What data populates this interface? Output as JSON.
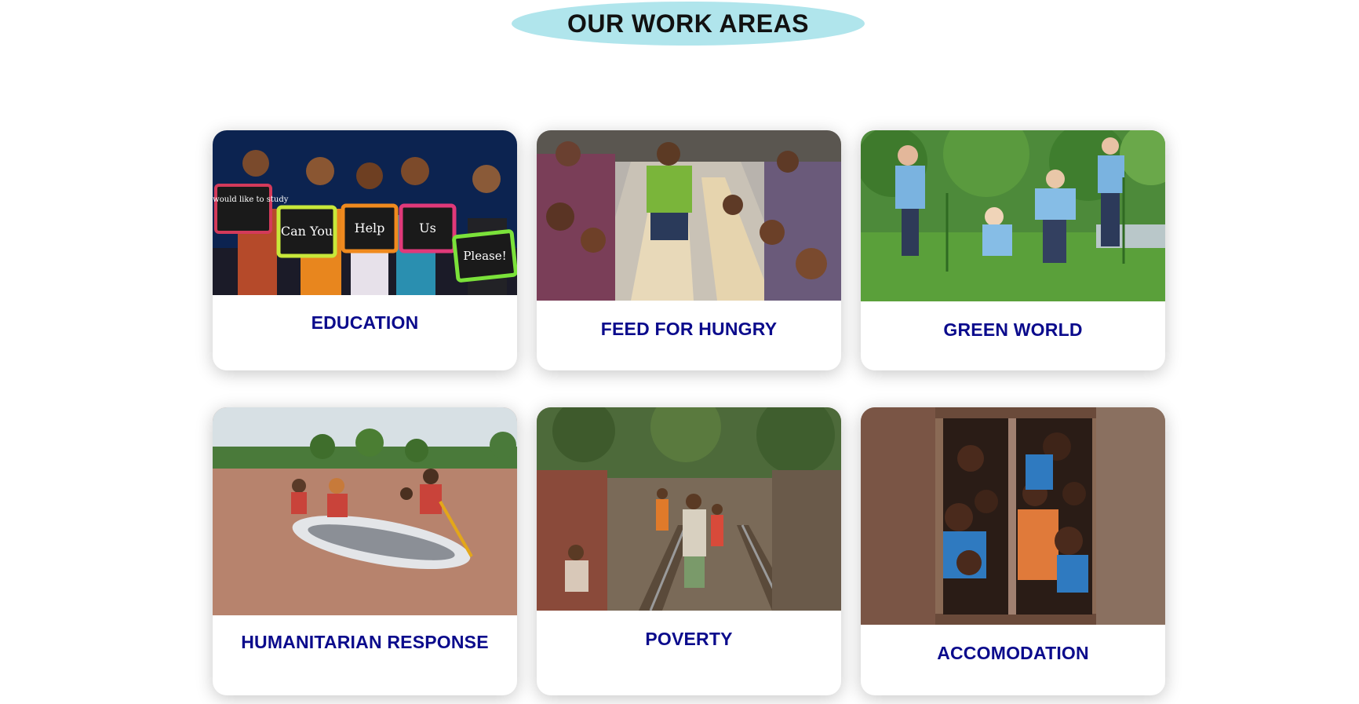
{
  "section": {
    "title": "OUR WORK AREAS"
  },
  "cards": [
    {
      "caption": "EDUCATION",
      "image": "children-holding-chalkboards",
      "chalkboards": [
        "We would like to study",
        "Can You",
        "Help",
        "Us",
        "Please!"
      ]
    },
    {
      "caption": "FEED FOR HUNGRY",
      "image": "community-meal-street"
    },
    {
      "caption": "GREEN WORLD",
      "image": "volunteers-planting-trees"
    },
    {
      "caption": "HUMANITARIAN RESPONSE",
      "image": "flood-rescue-raft"
    },
    {
      "caption": "POVERTY",
      "image": "railway-slum-market"
    },
    {
      "caption": "ACCOMODATION",
      "image": "children-at-window"
    }
  ],
  "colors": {
    "title_pill": "#b0e5ec",
    "caption_text": "#0b0b8c",
    "card_background": "#ffffff"
  }
}
